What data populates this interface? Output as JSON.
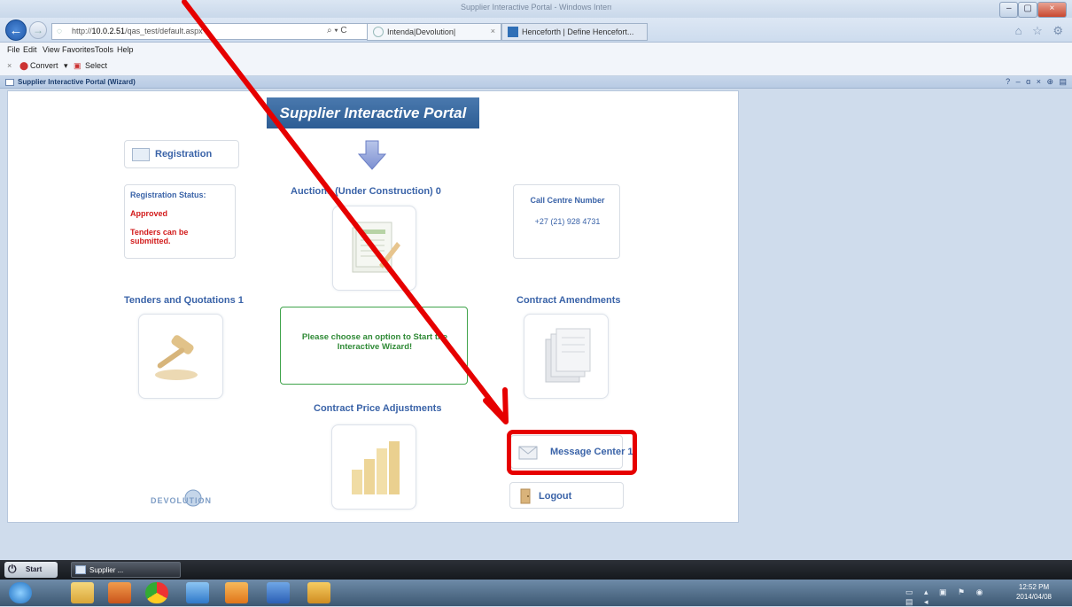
{
  "browser": {
    "window_title": "Supplier Interactive Portal - Windows Internet Explorer",
    "address_url_prefix": "http://",
    "address_url_host": "10.0.2.51",
    "address_url_path": "/qas_test/default.aspx",
    "search_symbol": "⌕ ▾ C",
    "tabs": [
      {
        "label": "Intenda|Devolution|"
      },
      {
        "label": "Henceforth | Define Hencefort..."
      }
    ],
    "tab_close": "×",
    "nav_icons": "⌂ ☆ ⚙"
  },
  "menu": [
    "File",
    "Edit",
    "View",
    "Favorites",
    "Tools",
    "Help"
  ],
  "command_bar": {
    "close": "×",
    "convert": "Convert",
    "convert_arrow": "▾",
    "select": "Select"
  },
  "portal_window_title": "Supplier Interactive Portal (Wizard)",
  "portal_window_controls": "? – ɑ × ⊕ ▤",
  "portal": {
    "header": "Supplier Interactive Portal",
    "registration_button": "Registration",
    "status_label": "Registration Status:",
    "status_value": "Approved",
    "status_note": "Tenders can be submitted.",
    "auctions_title": "Auctions (Under Construction) 0",
    "call_centre_label": "Call Centre Number",
    "call_centre_number": "+27 (21) 928 4731",
    "tenders_title": "Tenders and Quotations 1",
    "contract_amendments_title": "Contract Amendments",
    "wizard_message": "Please choose an option to Start the Interactive Wizard!",
    "price_adjustments_title": "Contract Price Adjustments",
    "message_center_button": "Message Center 1",
    "logout_button": "Logout",
    "logo_text": "DEVOLUTION"
  },
  "taskbar": {
    "start_label": "Start",
    "task_label": "Supplier ...",
    "clock_time": "12:52 PM",
    "clock_date": "2014/04/08",
    "tray_icons": "▭ ▴ ▣ ⚑ ◉ ▤ ◂"
  },
  "colors": {
    "accent_blue": "#3a63a8",
    "status_red": "#d21b1b",
    "wizard_green": "#2f8a36",
    "highlight_red": "#e60000"
  }
}
